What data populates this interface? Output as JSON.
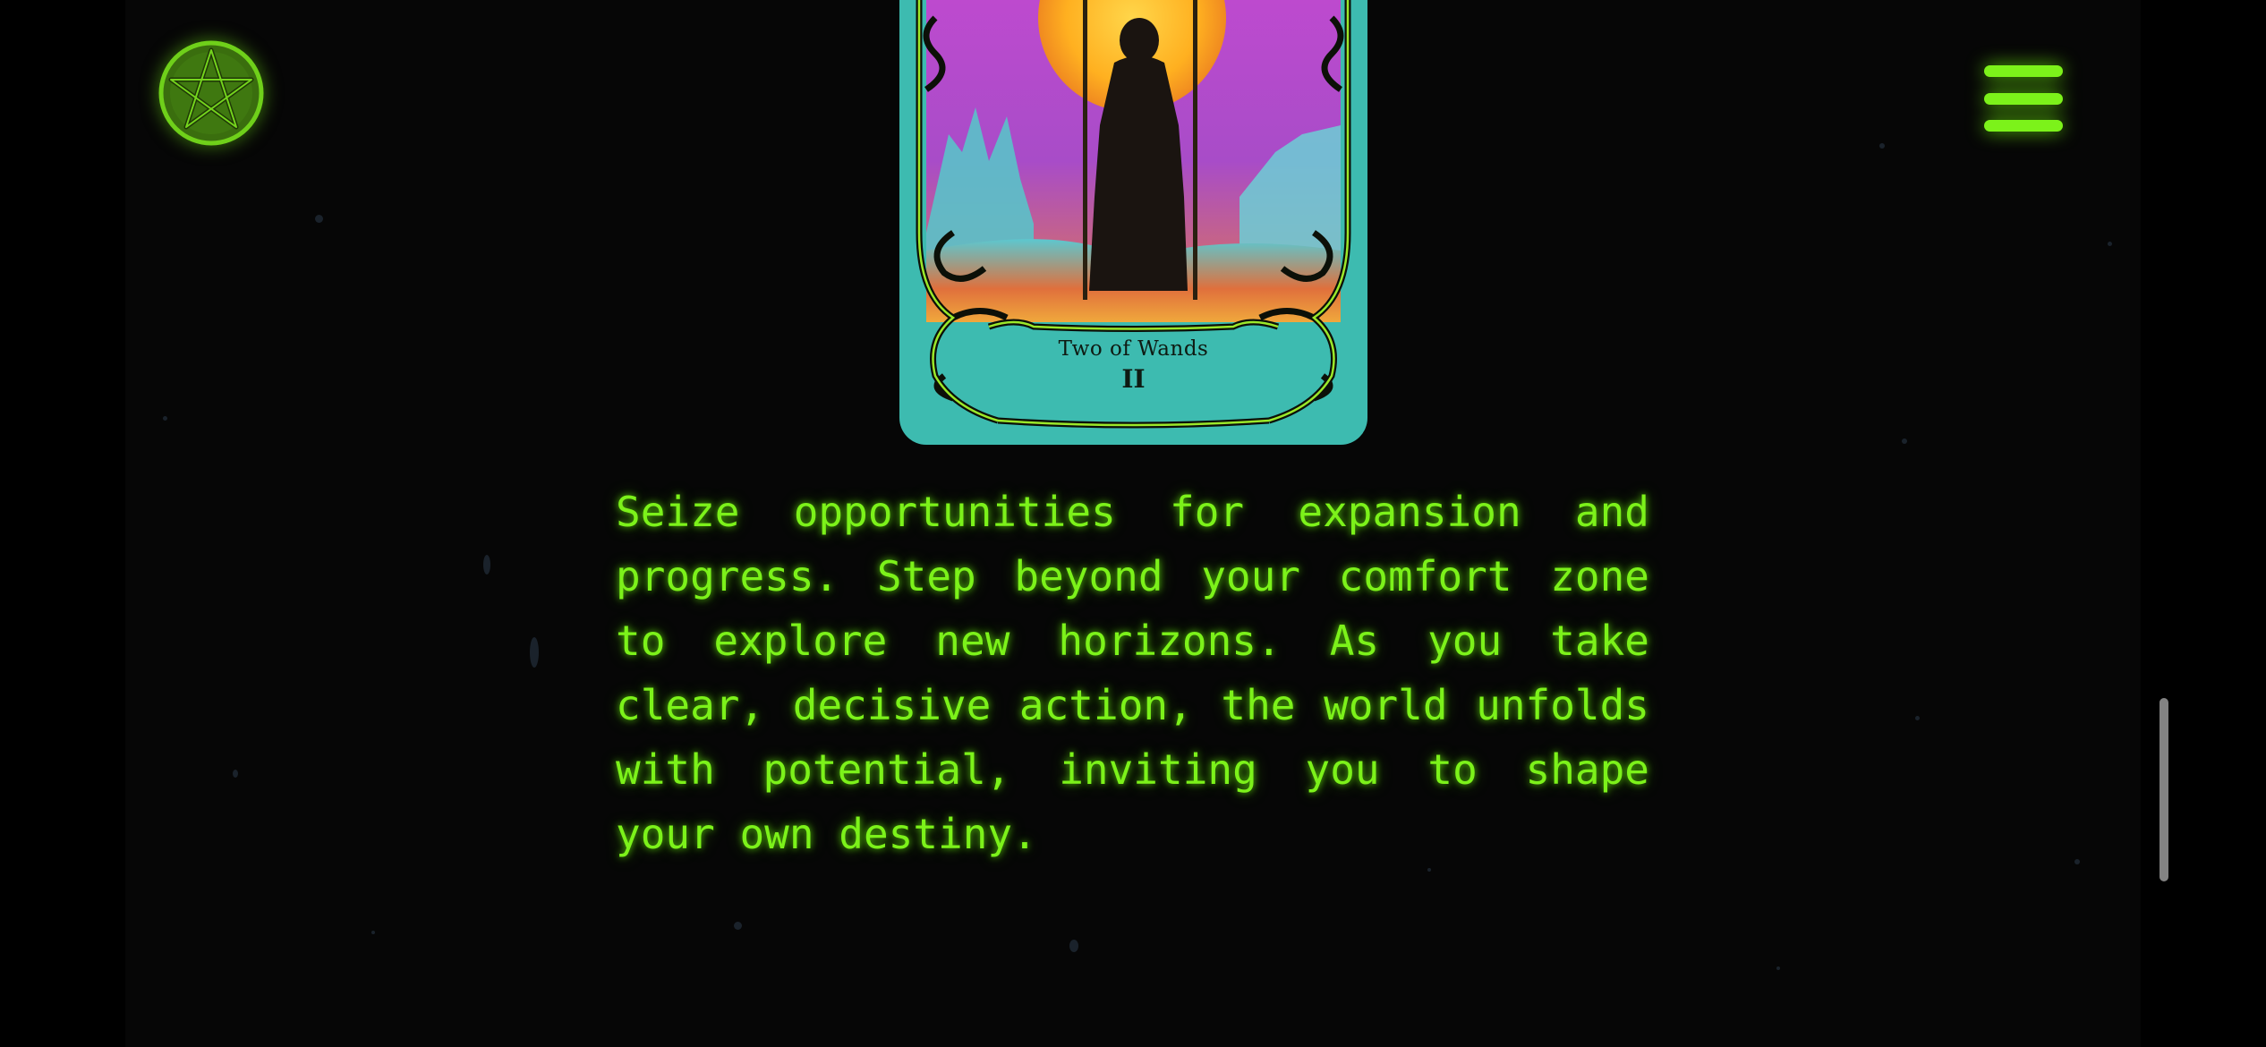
{
  "header": {
    "logo_icon": "pentagram-icon",
    "menu_icon": "hamburger-menu-icon"
  },
  "card": {
    "name": "Two of Wands",
    "numeral": "II"
  },
  "reading": {
    "text": "Seize opportunities for expansion and progress. Step beyond your comfort zone to explore new horizons. As you take clear, decisive action, the world unfolds with potential, inviting you to shape your own destiny."
  },
  "colors": {
    "accent": "#7cf21a",
    "background": "#060606",
    "card_teal": "#3dbbb0",
    "card_magenta": "#b050c8"
  }
}
